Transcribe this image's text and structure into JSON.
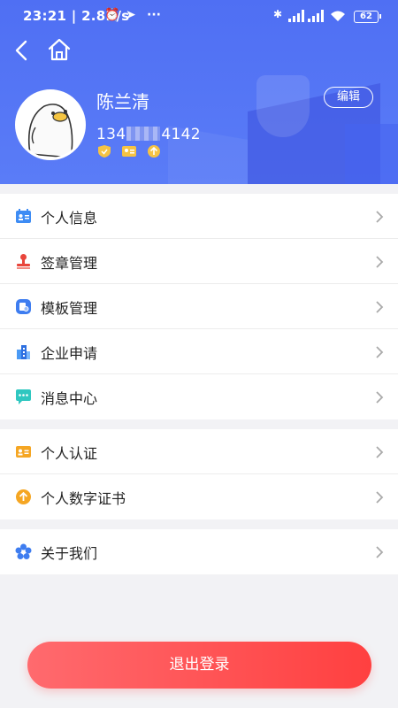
{
  "statusbar": {
    "time": "23:21 | 2.8K/s",
    "battery": "62"
  },
  "profile": {
    "name": "陈兰清",
    "phone_prefix": "134",
    "phone_suffix": "4142",
    "edit_label": "编辑"
  },
  "menu_group1": [
    {
      "label": "个人信息",
      "icon": "id-card-icon"
    },
    {
      "label": "签章管理",
      "icon": "stamp-icon"
    },
    {
      "label": "模板管理",
      "icon": "template-icon"
    },
    {
      "label": "企业申请",
      "icon": "building-icon"
    },
    {
      "label": "消息中心",
      "icon": "message-icon"
    }
  ],
  "menu_group2": [
    {
      "label": "个人认证",
      "icon": "certification-card-icon"
    },
    {
      "label": "个人数字证书",
      "icon": "digital-certificate-icon"
    }
  ],
  "menu_group3": [
    {
      "label": "关于我们",
      "icon": "flower-icon"
    }
  ],
  "logout_label": "退出登录",
  "colors": {
    "header": "#5575f5",
    "logout": "#ff4f50"
  }
}
